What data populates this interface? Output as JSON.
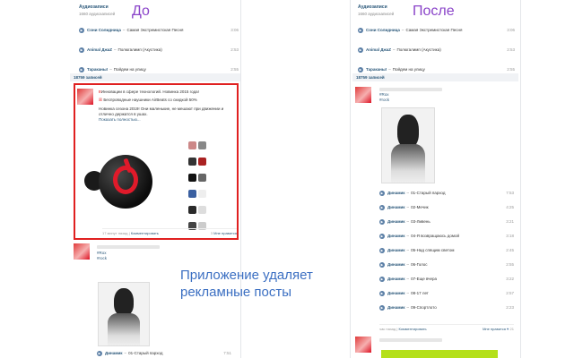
{
  "labels": {
    "before": "До",
    "after": "После",
    "caption": "Приложение удаляет рекламные посты"
  },
  "left": {
    "audio_header": "Аудиозаписи",
    "audio_count": "1660 аудиозаписей",
    "audios": [
      {
        "artist": "Сони Солидница",
        "title": "Самая Экстремистская Песня",
        "duration": "3:06"
      },
      {
        "artist": "Animal ДжаZ",
        "title": "Полюгалимп (Акустика)",
        "duration": "2:53"
      },
      {
        "artist": "Тараканы!",
        "title": "Пойдем на улицу",
        "duration": "2:55"
      }
    ],
    "wall_count": "18759 записей",
    "ad": {
      "headline": "Инновации в сфере технологий. Новинка 2015 года!",
      "product": "Беспроводные наушники AirBeats со скидкой 50%",
      "body": "Новинка сезона 2019! Они маленькие, не мешают при движении и отлично держатся в ушах.",
      "more": "Показать полностью...",
      "time": "17 минут назад",
      "comment": "Комментировать",
      "likes": "3",
      "share": "Мне нравится"
    },
    "post2": {
      "tags": [
        "#Rox",
        "#rock"
      ],
      "track_artist": "Динамик",
      "track_title": "01-Старый парход",
      "track_duration": "7:51"
    }
  },
  "right": {
    "audio_header": "Аудиозаписи",
    "audio_count": "1660 аудиозаписей",
    "audios": [
      {
        "artist": "Сони Солидница",
        "title": "Самая Экстремистская Песня",
        "duration": "3:06"
      },
      {
        "artist": "Animal ДжаZ",
        "title": "Полюгалимп (Акустика)",
        "duration": "2:53"
      },
      {
        "artist": "Тараканы!",
        "title": "Пойдем на улицу",
        "duration": "2:55"
      }
    ],
    "wall_count": "18759 записей",
    "post": {
      "tags": [
        "#Rox",
        "#rock"
      ],
      "tracks": [
        {
          "artist": "Динамик",
          "title": "01-Старый парход",
          "duration": "7:53"
        },
        {
          "artist": "Динамик",
          "title": "02-Мечик",
          "duration": "4:25"
        },
        {
          "artist": "Динамик",
          "title": "03-Ливень",
          "duration": "3:21"
        },
        {
          "artist": "Динамик",
          "title": "04-Я возвращаюсь домой",
          "duration": "3:18"
        },
        {
          "artist": "Динамик",
          "title": "05-Над спящим светом",
          "duration": "2:45"
        },
        {
          "artist": "Динамик",
          "title": "06-Голос",
          "duration": "2:55"
        },
        {
          "artist": "Динамик",
          "title": "07-Еще вчера",
          "duration": "3:22"
        },
        {
          "artist": "Динамик",
          "title": "08-17 лет",
          "duration": "2:57"
        },
        {
          "artist": "Динамик",
          "title": "09-Спортлото",
          "duration": "2:23"
        }
      ],
      "time": "час назад",
      "comment": "Комментировать",
      "share": "Мне нравится",
      "likes": "21"
    }
  },
  "colors": {
    "accent_label": "#8a44c9",
    "caption": "#3b6fc2",
    "ad_border": "#e02020",
    "vk_link": "#2b587a"
  }
}
